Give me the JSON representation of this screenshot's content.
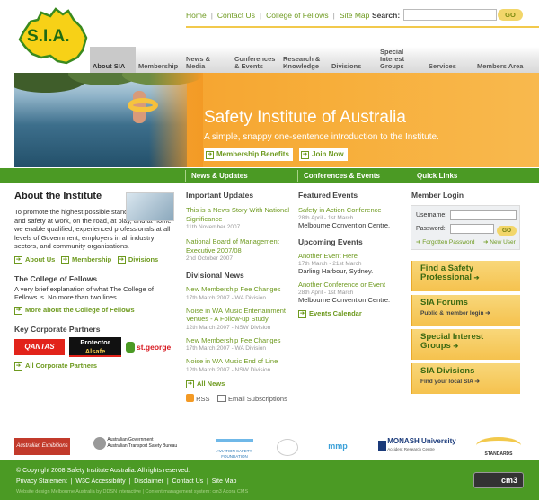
{
  "logo": {
    "text": "S.I.A."
  },
  "toplinks": [
    "Home",
    "Contact Us",
    "College of Fellows",
    "Site Map"
  ],
  "search": {
    "label": "Search:",
    "placeholder": "",
    "go": "GO"
  },
  "nav": [
    {
      "label": "About SIA",
      "active": true
    },
    {
      "label": "Membership",
      "active": false
    },
    {
      "label": "News & Media",
      "active": false
    },
    {
      "label": "Conferences & Events",
      "active": false
    },
    {
      "label": "Research & Knowledge",
      "active": false
    },
    {
      "label": "Divisions",
      "active": false
    },
    {
      "label": "Special Interest Groups",
      "active": false
    },
    {
      "label": "Services",
      "active": false
    },
    {
      "label": "Members Area",
      "active": false
    }
  ],
  "banner": {
    "title": "Safety Institute of Australia",
    "subtitle": "A simple, snappy one-sentence introduction to the Institute.",
    "btn_membership": "Membership Benefits",
    "btn_join": "Join Now"
  },
  "greenbar": {
    "news": "News & Updates",
    "events": "Conferences & Events",
    "quick": "Quick Links"
  },
  "about": {
    "title": "About the Institute",
    "text": "To promote the highest possible standards of health and safety at work, on the road, at play, and at home, we enable qualified, experienced professionals at all levels of Government, employers in all industry sectors, and community organisations.",
    "links": [
      "About Us",
      "Membership",
      "Divisions"
    ],
    "fellows_title": "The College of Fellows",
    "fellows_text": "A very brief explanation of what The College of Fellows is. No more than two lines.",
    "fellows_link": "More about the College of Fellows",
    "partners_title": "Key Corporate Partners",
    "partner_qantas": "QANTAS",
    "partner_protector_1": "Protector",
    "partner_protector_2": "Alsafe",
    "partner_stgeorge": "st.george",
    "partners_link": "All Corporate Partners"
  },
  "updates": {
    "title": "Important Updates",
    "items": [
      {
        "title": "This is a News Story With National Significance",
        "date": "11th November 2007"
      },
      {
        "title": "National Board of Management Executive 2007/08",
        "date": "2nd October 2007"
      }
    ],
    "div_title": "Divisional News",
    "div_items": [
      {
        "title": "New Membership Fee Changes",
        "date": "17th March 2007 - WA Division"
      },
      {
        "title": "Noise in WA Music Entertainment Venues - A Follow-up Study",
        "date": "12th March 2007 - NSW Division"
      },
      {
        "title": "New Membership Fee Changes",
        "date": "17th March 2007 - WA Division"
      },
      {
        "title": "Noise in WA Music End of Line",
        "date": "12th March 2007 - NSW Division"
      }
    ],
    "all_news": "All News",
    "rss": "RSS",
    "email": "Email Subscriptions"
  },
  "events": {
    "featured_title": "Featured Events",
    "featured": [
      {
        "title": "Safety in Action Conference",
        "date": "28th April - 1st March",
        "place": "Melbourne Convention Centre."
      }
    ],
    "upcoming_title": "Upcoming Events",
    "upcoming": [
      {
        "title": "Another Event Here",
        "date": "17th March - 21st March",
        "place": "Darling Harbour, Sydney."
      },
      {
        "title": "Another Conference or Event",
        "date": "28th April - 1st March",
        "place": "Melbourne Convention Centre."
      }
    ],
    "calendar": "Events Calendar"
  },
  "login": {
    "title": "Member Login",
    "username": "Username:",
    "password": "Password:",
    "go": "GO",
    "forgotten": "Forgotten Password",
    "new_user": "New User"
  },
  "quicklinks": [
    {
      "title": "Find a Safety Professional",
      "sub": ""
    },
    {
      "title": "SIA Forums",
      "sub": "Public & member login"
    },
    {
      "title": "Special Interest Groups",
      "sub": ""
    },
    {
      "title": "SIA Divisions",
      "sub": "Find your local SIA"
    }
  ],
  "partner_logos": {
    "australian_exhibitions": "Australian Exhibitions",
    "atsb_1": "Australian Government",
    "atsb_2": "Australian Transport Safety Bureau",
    "aviation": "AVIATION SAFETY FOUNDATION",
    "mmp": "mmp",
    "monash_1": "MONASH University",
    "monash_2": "Accident Research Centre",
    "standards": "STANDARDS"
  },
  "footer": {
    "copyright": "© Copyright 2008 Safety Institute Australia. All rights reserved.",
    "links": [
      "Privacy Statement",
      "W3C Accessibility",
      "Disclaimer",
      "Contact Us",
      "Site Map"
    ],
    "credit": "Website design Melbourne Australia by DDSN Interactive | Content management system: cm3 Acora CMS",
    "badge": "cm3"
  },
  "colors": {
    "green": "#4b9a24",
    "link_green": "#6e9a1f",
    "orange": "#f39a25",
    "yellow": "#f5c24e"
  }
}
